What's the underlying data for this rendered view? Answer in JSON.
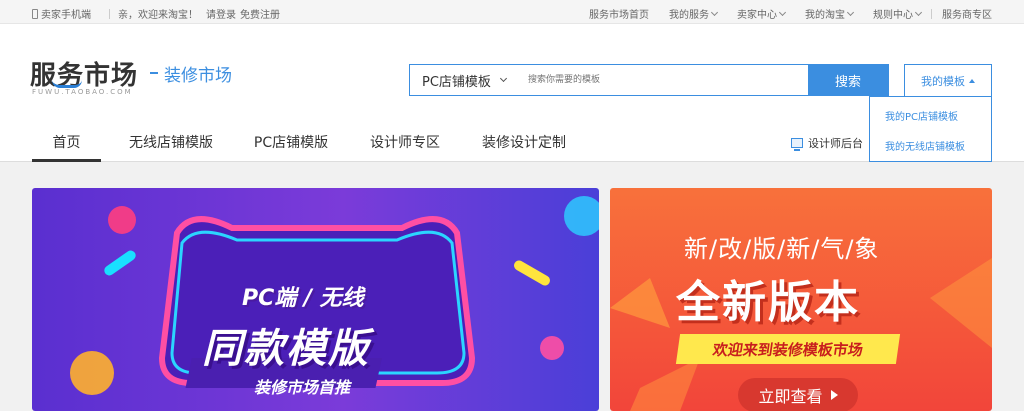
{
  "topbar": {
    "seller_mobile": "卖家手机端",
    "welcome": "亲，欢迎来淘宝！",
    "login": "请登录",
    "register": "免费注册",
    "links": [
      "服务市场首页",
      "我的服务",
      "卖家中心",
      "我的淘宝",
      "规则中心"
    ],
    "provider_zone": "服务商专区"
  },
  "logo": {
    "main": "服务市场",
    "sub": "FUWU.TAOBAO.COM",
    "section": "装修市场"
  },
  "search": {
    "category": "PC店铺模板",
    "placeholder": "搜索你需要的模板",
    "button": "搜索"
  },
  "my_templates": {
    "label": "我的模板",
    "items": [
      "我的PC店铺模板",
      "我的无线店铺模板"
    ]
  },
  "nav": {
    "tabs": [
      "首页",
      "无线店铺模版",
      "PC店铺模版",
      "设计师专区",
      "装修设计定制"
    ],
    "designer_backend": "设计师后台"
  },
  "banner_left": {
    "line1": "PC端 / 无线",
    "line2": "同款模版",
    "line3": "装修市场首推"
  },
  "banner_right": {
    "line1": "新/改/版/新/气/象",
    "line2": "全新版本",
    "line3": "欢迎来到装修模板市场",
    "button": "立即查看"
  },
  "colors": {
    "accent": "#3b8ee0",
    "left_banner": "#6a34d6",
    "right_banner": "#f55a3a",
    "highlight": "#ffe84d"
  }
}
